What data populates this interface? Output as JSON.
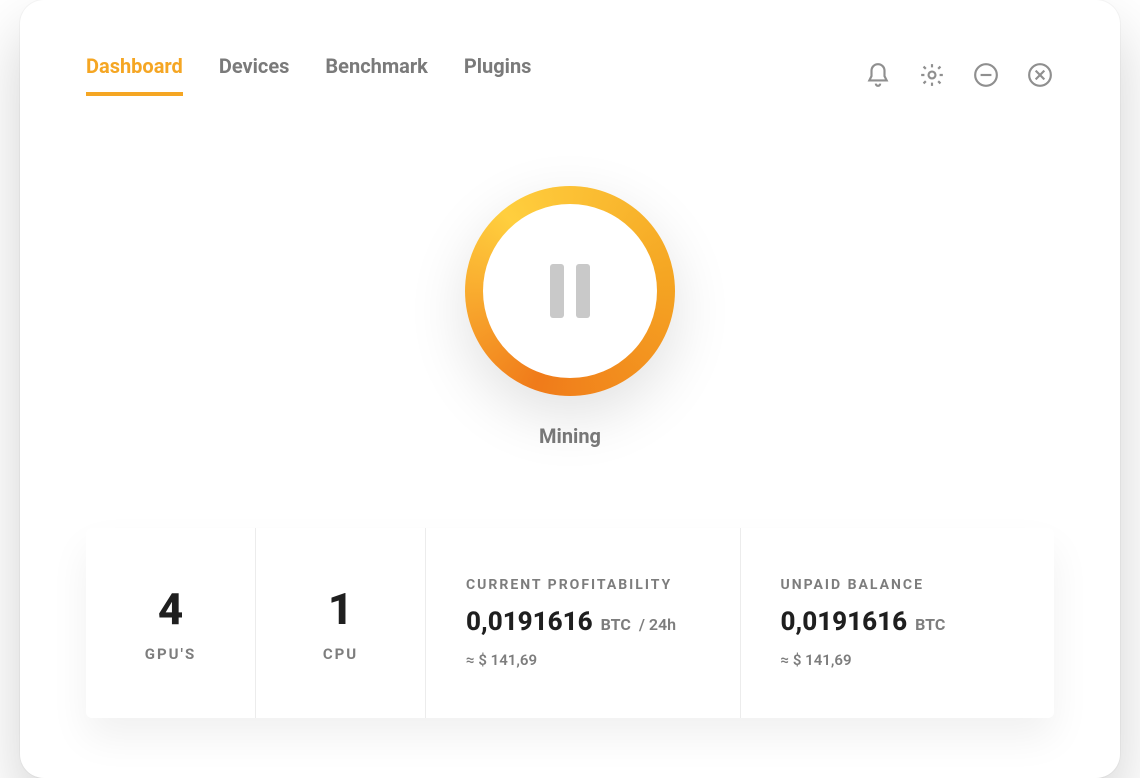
{
  "colors": {
    "accent": "#f5a623"
  },
  "nav": {
    "tabs": [
      {
        "label": "Dashboard",
        "active": true
      },
      {
        "label": "Devices",
        "active": false
      },
      {
        "label": "Benchmark",
        "active": false
      },
      {
        "label": "Plugins",
        "active": false
      }
    ]
  },
  "toolbar": {
    "icons": [
      "bell-icon",
      "gear-icon",
      "minimize-icon",
      "close-icon"
    ]
  },
  "mining": {
    "state_label": "Mining",
    "control_icon": "pause-icon"
  },
  "stats": {
    "gpu": {
      "count": "4",
      "label": "GPU'S"
    },
    "cpu": {
      "count": "1",
      "label": "CPU"
    },
    "profitability": {
      "title": "CURRENT PROFITABILITY",
      "value": "0,0191616",
      "unit": "BTC",
      "suffix": "/ 24h",
      "approx": "≈ $ 141,69"
    },
    "balance": {
      "title": "UNPAID BALANCE",
      "value": "0,0191616",
      "unit": "BTC",
      "approx": "≈ $ 141,69"
    }
  }
}
